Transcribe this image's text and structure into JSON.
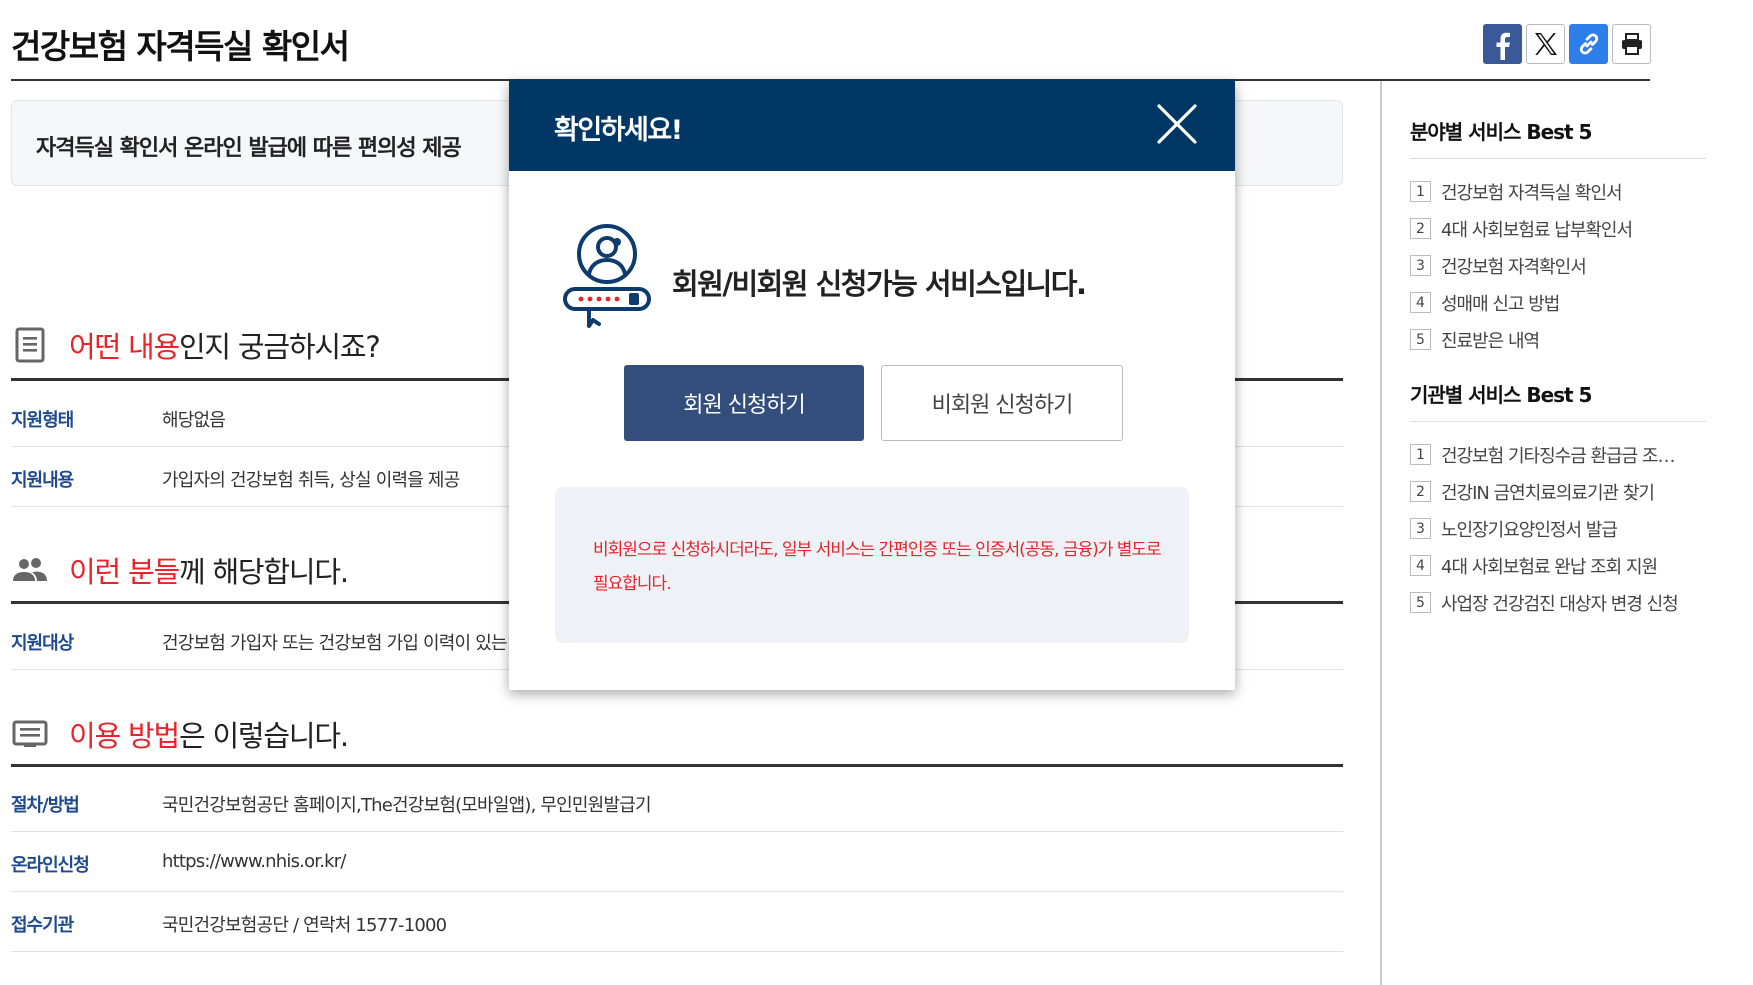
{
  "header": {
    "title": "건강보험 자격득실 확인서",
    "share": [
      {
        "name": "facebook-icon",
        "color": "#3b5998"
      },
      {
        "name": "x-icon",
        "color": "#000000"
      },
      {
        "name": "link-icon",
        "color": "#2d7ee8"
      },
      {
        "name": "print-icon",
        "color": "#222222"
      }
    ]
  },
  "summary": "자격득실 확인서 온라인 발급에 따른 편의성 제공",
  "sections": [
    {
      "heading_highlight": "어떤 내용",
      "heading_rest": "인지 궁금하시죠?",
      "icon": "document-icon",
      "rows": [
        {
          "label": "지원형태",
          "value": "해당없음"
        },
        {
          "label": "지원내용",
          "value": "가입자의 건강보험 취득, 상실 이력을 제공"
        }
      ]
    },
    {
      "heading_highlight": "이런 분들",
      "heading_rest": "께 해당합니다.",
      "icon": "people-icon",
      "rows": [
        {
          "label": "지원대상",
          "value": "건강보험 가입자 또는 건강보험 가입 이력이 있는 사"
        }
      ]
    },
    {
      "heading_highlight": "이용 방법",
      "heading_rest": "은 이렇습니다.",
      "icon": "list-icon",
      "rows": [
        {
          "label": "절차/방법",
          "value": "국민건강보험공단 홈페이지,The건강보험(모바일앱), 무인민원발급기"
        },
        {
          "label": "온라인신청",
          "value": "https://www.nhis.or.kr/"
        },
        {
          "label": "접수기관",
          "value": "국민건강보험공단 / 연락처 1577-1000"
        }
      ]
    }
  ],
  "sidebar": {
    "field_best": {
      "title": "분야별 서비스 Best 5",
      "items": [
        {
          "num": "1",
          "label": "건강보험 자격득실 확인서"
        },
        {
          "num": "2",
          "label": "4대 사회보험료 납부확인서"
        },
        {
          "num": "3",
          "label": "건강보험 자격확인서"
        },
        {
          "num": "4",
          "label": "성매매 신고 방법"
        },
        {
          "num": "5",
          "label": "진료받은 내역"
        }
      ]
    },
    "org_best": {
      "title": "기관별 서비스 Best 5",
      "items": [
        {
          "num": "1",
          "label": "건강보험 기타징수금 환급금 조…"
        },
        {
          "num": "2",
          "label": "건강IN 금연치료의료기관 찾기"
        },
        {
          "num": "3",
          "label": "노인장기요양인정서 발급"
        },
        {
          "num": "4",
          "label": "4대 사회보험료 완납 조회 지원"
        },
        {
          "num": "5",
          "label": "사업장 건강검진 대상자 변경 신청"
        }
      ]
    }
  },
  "modal": {
    "title": "확인하세요!",
    "message": "회원/비회원 신청가능 서비스입니다.",
    "member_button": "회원 신청하기",
    "nonmember_button": "비회원 신청하기",
    "notice": "비회원으로 신청하시더라도, 일부 서비스는 간편인증 또는 인증서(공동, 금융)가 별도로 필요합니다.",
    "header_color": "#003764",
    "member_button_color": "#334e7d",
    "notice_color": "#e8232a"
  }
}
